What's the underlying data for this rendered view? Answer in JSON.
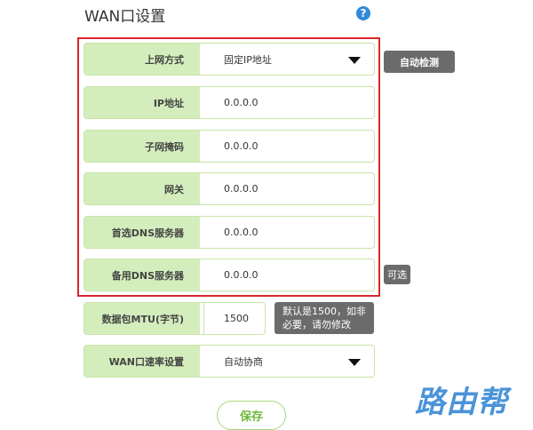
{
  "page": {
    "title": "WAN口设置",
    "help_icon": "question-circle-icon",
    "help_glyph": "?"
  },
  "fields": {
    "connection_type": {
      "label": "上网方式",
      "value": "固定IP地址"
    },
    "ip": {
      "label": "IP地址",
      "value": "0.0.0.0"
    },
    "subnet": {
      "label": "子网掩码",
      "value": "0.0.0.0"
    },
    "gateway": {
      "label": "网关",
      "value": "0.0.0.0"
    },
    "dns_primary": {
      "label": "首选DNS服务器",
      "value": "0.0.0.0"
    },
    "dns_secondary": {
      "label": "备用DNS服务器",
      "value": "0.0.0.0"
    },
    "mtu": {
      "label": "数据包MTU(字节)",
      "value": "1500"
    },
    "wan_speed": {
      "label": "WAN口速率设置",
      "value": "自动协商"
    }
  },
  "buttons": {
    "auto_detect": "自动检测",
    "save": "保存"
  },
  "tags": {
    "optional": "可选",
    "mtu_hint_line1": "默认是1500，如非",
    "mtu_hint_line2": "必要，请勿修改"
  },
  "watermark": "路由帮",
  "colors": {
    "label_bg": "#d3eebc",
    "field_border": "#c9e3a8",
    "highlight_border": "#d7262c",
    "tag_bg": "#6b6b6b",
    "save_text": "#6eb93d",
    "help_icon": "#2e8ad8",
    "watermark": "#4a93d8"
  }
}
